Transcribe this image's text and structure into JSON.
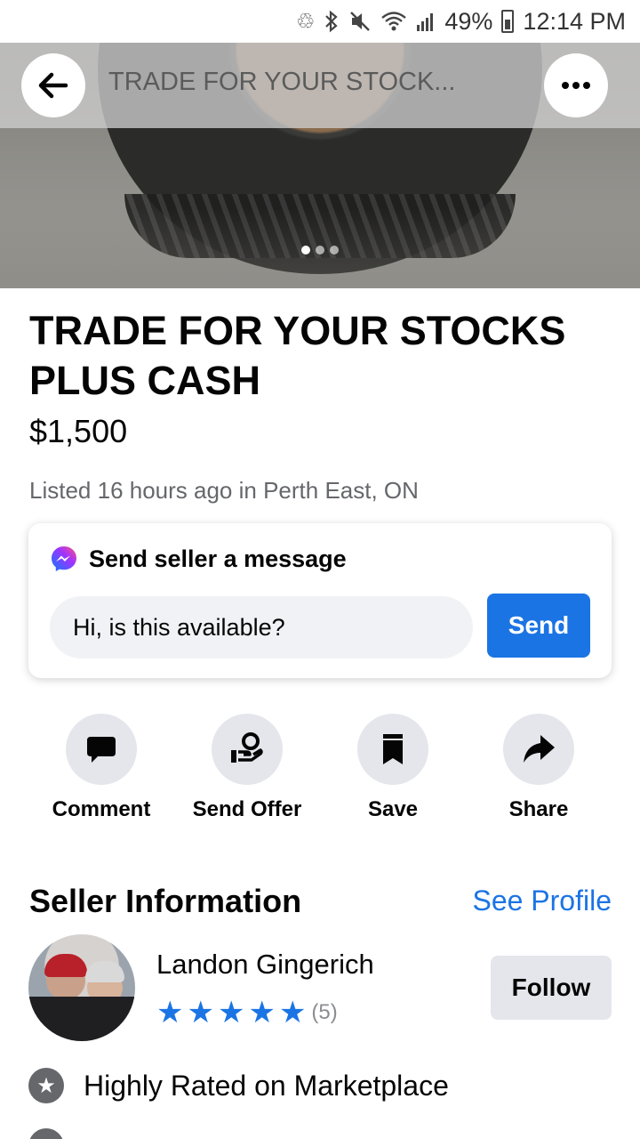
{
  "status_bar": {
    "battery": "49%",
    "time": "12:14 PM",
    "icons": [
      "recycle-icon",
      "bluetooth-icon",
      "mute-icon",
      "wifi-icon",
      "signal-icon",
      "battery-icon"
    ]
  },
  "header": {
    "title": "TRADE FOR YOUR STOCK..."
  },
  "carousel": {
    "count": 3,
    "active_index": 0
  },
  "listing": {
    "title": "TRADE FOR YOUR STOCKS PLUS CASH",
    "price": "$1,500",
    "meta": "Listed 16 hours ago in Perth East, ON"
  },
  "message": {
    "heading": "Send seller a message",
    "input_value": "Hi, is this available?",
    "send_label": "Send"
  },
  "actions": [
    {
      "label": "Comment",
      "icon": "comment-icon"
    },
    {
      "label": "Send Offer",
      "icon": "offer-icon"
    },
    {
      "label": "Save",
      "icon": "bookmark-icon"
    },
    {
      "label": "Share",
      "icon": "share-icon"
    }
  ],
  "seller": {
    "heading": "Seller Information",
    "see_profile": "See Profile",
    "name": "Landon Gingerich",
    "rating": 5,
    "rating_count": "(5)",
    "follow_label": "Follow",
    "badge": "Highly Rated on Marketplace"
  },
  "colors": {
    "accent": "#1b74e4",
    "text_primary": "#050505",
    "text_secondary": "#65676b",
    "button_bg": "#e4e6eb"
  }
}
